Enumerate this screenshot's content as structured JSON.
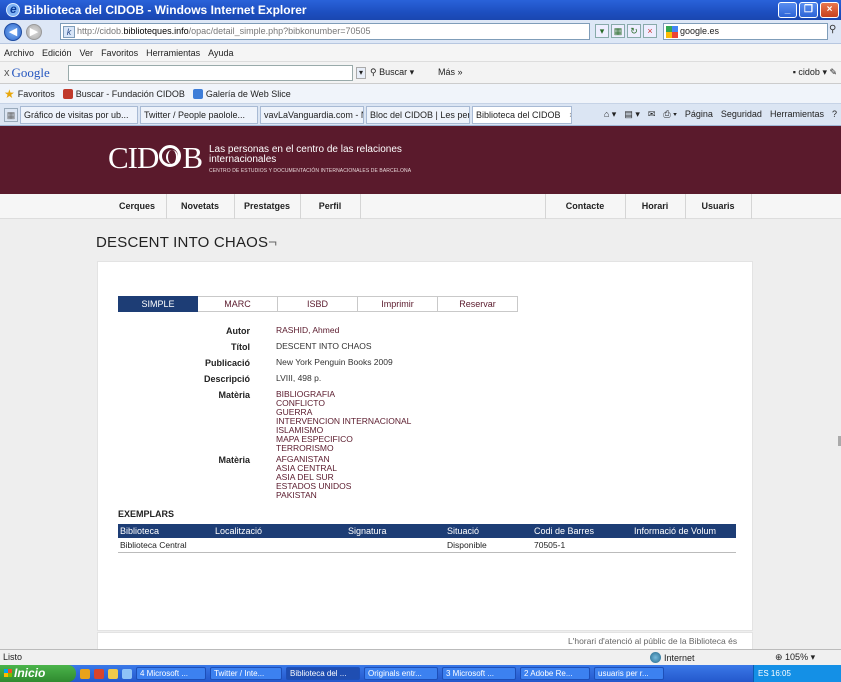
{
  "window": {
    "title": "Biblioteca del CIDOB - Windows Internet Explorer",
    "url_prefix": "http://cidob.",
    "url_host": "biblioteques.info",
    "url_path": "/opac/detail_simple.php?bibkonumber=70505",
    "search_text": "google.es"
  },
  "menu": [
    "Archivo",
    "Edición",
    "Ver",
    "Favoritos",
    "Herramientas",
    "Ayuda"
  ],
  "googlebar": {
    "close": "x",
    "logo": "Google",
    "buscar": "Buscar",
    "mas": "Más »",
    "user": "cidob"
  },
  "favorites": {
    "label": "Favoritos",
    "items": [
      "Buscar - Fundación CIDOB",
      "Galería de Web Slice"
    ]
  },
  "tabs": {
    "items": [
      "Gráfico de visitas por ub...",
      "Twitter / People paolole...",
      "vavLaVanguardia.com - Noti...",
      "Bloc del CIDOB | Les per...",
      "Biblioteca del CIDOB"
    ],
    "tools": [
      "Página",
      "Seguridad",
      "Herramientas"
    ]
  },
  "site": {
    "brand": "CIDOB",
    "tagline": "Las personas en el centro de las relaciones internacionales",
    "tagline_sub": "CENTRO DE ESTUDIOS Y DOCUMENTACIÓN INTERNACIONALES DE BARCELONA",
    "nav_left": [
      "Cerques",
      "Novetats",
      "Prestatges",
      "Perfil"
    ],
    "nav_right": [
      "Contacte",
      "Horari",
      "Usuaris"
    ]
  },
  "record": {
    "title": "DESCENT INTO CHAOS",
    "view_tabs": [
      "SIMPLE",
      "MARC",
      "ISBD",
      "Imprimir",
      "Reservar"
    ],
    "fields": {
      "autor_label": "Autor",
      "autor": "RASHID, Ahmed",
      "titol_label": "Títol",
      "titol": "DESCENT INTO CHAOS",
      "publicacio_label": "Publicació",
      "publicacio": "New York Penguin Books 2009",
      "descripcio_label": "Descripció",
      "descripcio": "LVIII, 498 p.",
      "materia_label": "Matèria",
      "materia_1": [
        "BIBLIOGRAFIA",
        "CONFLICTO",
        "GUERRA",
        "INTERVENCION INTERNACIONAL",
        "ISLAMISMO",
        "MAPA ESPECIFICO",
        "TERRORISMO"
      ],
      "materia_2": [
        "AFGANISTAN",
        "ASIA CENTRAL",
        "ASIA DEL SUR",
        "ESTADOS UNIDOS",
        "PAKISTAN"
      ]
    },
    "exemplars_heading": "EXEMPLARS",
    "table_headers": [
      "Biblioteca",
      "Localització",
      "Signatura",
      "Situació",
      "Codi de Barres",
      "Informació de Volum"
    ],
    "table_rows": [
      [
        "Biblioteca Central",
        "",
        "",
        "Disponible",
        "70505-1",
        ""
      ]
    ],
    "footer_note": "L'horari d'atenció al públic de la Biblioteca és"
  },
  "status": {
    "text": "Listo",
    "zone": "Internet",
    "zoom": "105%"
  },
  "taskbar": {
    "start": "Inicio",
    "tasks": [
      "4 Microsoft ...",
      "Twitter / Inte...",
      "Biblioteca del ...",
      "Originals entr...",
      "3 Microsoft ...",
      "2 Adobe Re...",
      "usuaris per r..."
    ],
    "tray": "ES  16:05"
  },
  "colors": {
    "banner": "#5a1a2c",
    "accent": "#1d3d75",
    "link": "#5a1a2c"
  }
}
